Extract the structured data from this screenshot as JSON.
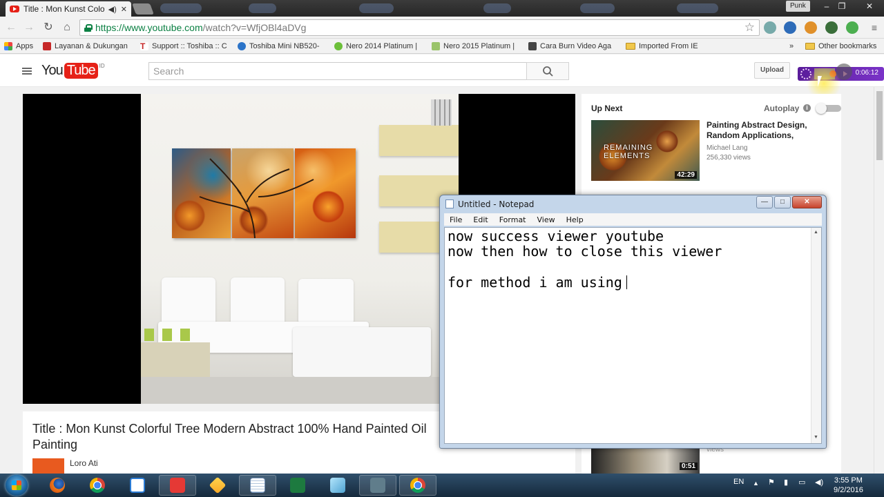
{
  "browser": {
    "tab_title": "Title : Mon Kunst Colo",
    "window_user": "Punk",
    "url_secure": "https://www.youtube.com",
    "url_path": "/watch?v=WfjOBl4aDVg"
  },
  "bookmarks": {
    "apps": "Apps",
    "items": [
      "Layanan & Dukungan",
      "Support :: Toshiba :: C",
      "Toshiba Mini NB520-",
      "Nero 2014 Platinum |",
      "Nero 2015 Platinum |",
      "Cara Burn Video Aga",
      "Imported From IE"
    ],
    "overflow": "»",
    "other": "Other bookmarks"
  },
  "youtube": {
    "logo_you": "You",
    "logo_tube": "Tube",
    "logo_region": "ID",
    "search_placeholder": "Search",
    "upload_label": "Upload",
    "viewer_time": "0:06:12"
  },
  "video": {
    "title": "Title : Mon Kunst Colorful Tree Modern Abstract 100% Hand Painted Oil Painting",
    "channel": "Loro Ati"
  },
  "sidebar": {
    "up_next": "Up Next",
    "autoplay": "Autoplay",
    "info_glyph": "i",
    "recommendation": {
      "title": "Painting Abstract Design, Random Applications,",
      "channel": "Michael Lang",
      "views": "256,330 views",
      "duration": "42:29",
      "thumb_text": "REMAINING ELEMENTS"
    },
    "recommendation_2": {
      "duration": "0:51",
      "views": "views"
    }
  },
  "notepad": {
    "title": "Untitled - Notepad",
    "menus": [
      "File",
      "Edit",
      "Format",
      "View",
      "Help"
    ],
    "lines": [
      "now success viewer youtube",
      "now then how to close this viewer",
      "",
      "for method i am using"
    ],
    "controls": {
      "minimize": "—",
      "maximize": "□",
      "close": "✕"
    }
  },
  "taskbar": {
    "language": "EN",
    "time": "3:55 PM",
    "date": "9/2/2016"
  },
  "colors": {
    "youtube_red": "#e62117",
    "secure_green": "#0b8043",
    "viewer_purple": "#6a2bb8",
    "taskbar": "#1f3a55"
  },
  "icons": {
    "back": "←",
    "forward": "→",
    "reload": "↻",
    "home": "⌂",
    "star": "☆",
    "search": "⌕",
    "minimize": "–",
    "restore": "❐",
    "close": "✕"
  }
}
